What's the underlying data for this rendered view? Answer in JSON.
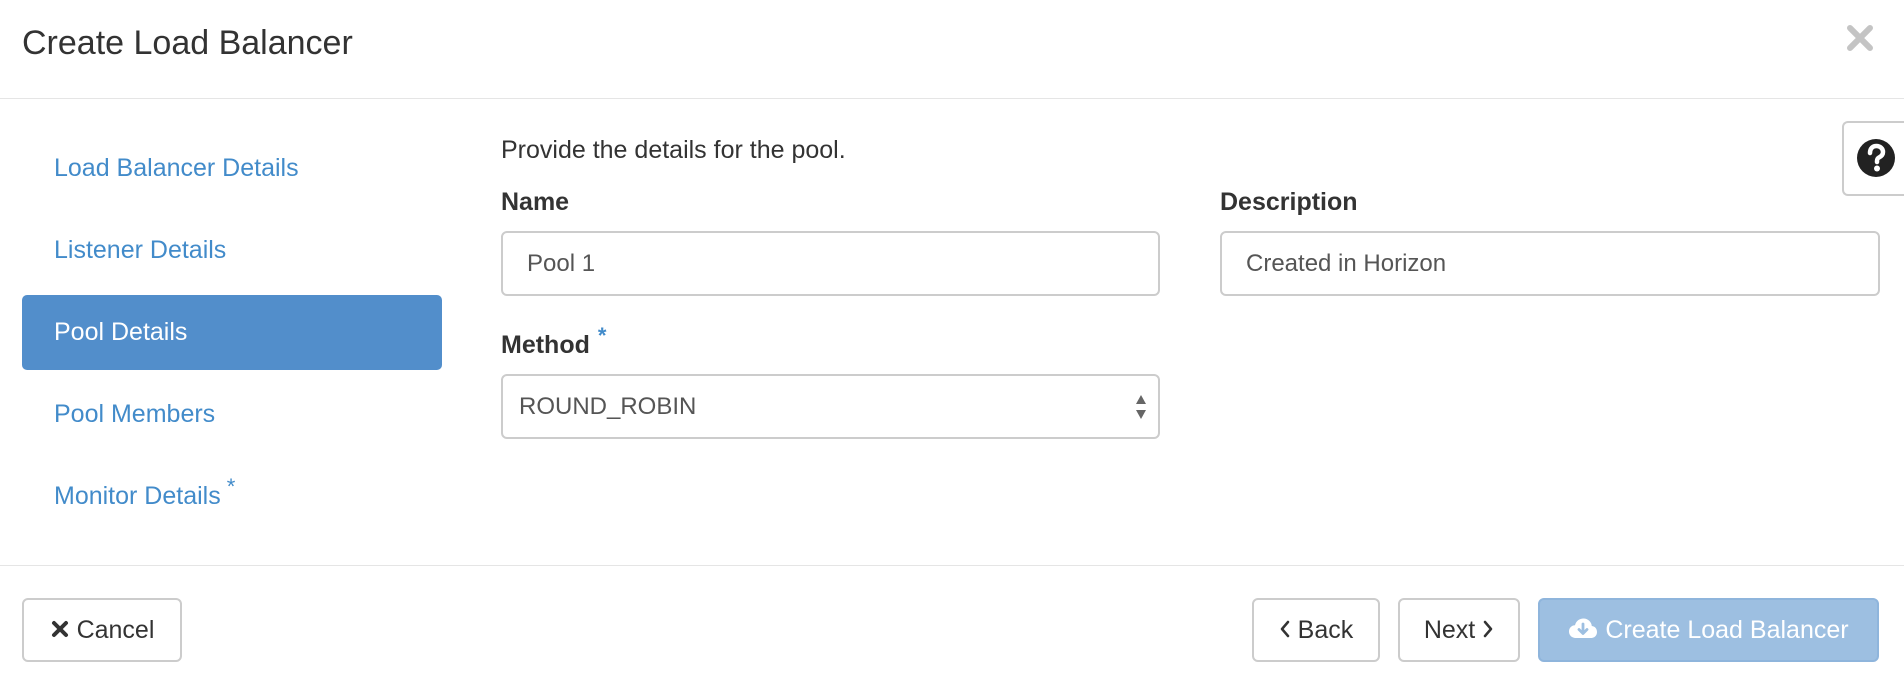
{
  "dialog": {
    "title": "Create Load Balancer"
  },
  "sidebar": {
    "items": [
      {
        "label": "Load Balancer Details",
        "active": false,
        "required": false
      },
      {
        "label": "Listener Details",
        "active": false,
        "required": false
      },
      {
        "label": "Pool Details",
        "active": true,
        "required": false
      },
      {
        "label": "Pool Members",
        "active": false,
        "required": false
      },
      {
        "label": "Monitor Details",
        "active": false,
        "required": true,
        "required_mark": "*"
      }
    ]
  },
  "main": {
    "intro": "Provide the details for the pool.",
    "name_field": {
      "label": "Name",
      "value": "Pool 1"
    },
    "description_field": {
      "label": "Description",
      "value": "Created in Horizon"
    },
    "method_field": {
      "label": "Method",
      "required_mark": "*",
      "value": "ROUND_ROBIN"
    }
  },
  "footer": {
    "cancel_label": "Cancel",
    "back_label": "Back",
    "next_label": "Next",
    "create_label": "Create Load Balancer"
  },
  "icons": {
    "close": "close-icon",
    "help": "question-circle-icon",
    "cancel": "times-icon",
    "back": "chevron-left-icon",
    "next": "chevron-right-icon",
    "create": "cloud-download-icon",
    "select": "sort-arrows-icon"
  },
  "colors": {
    "accent": "#428bca",
    "active_nav_bg": "#528ecb",
    "disabled_primary_bg": "#9dbfe1"
  }
}
